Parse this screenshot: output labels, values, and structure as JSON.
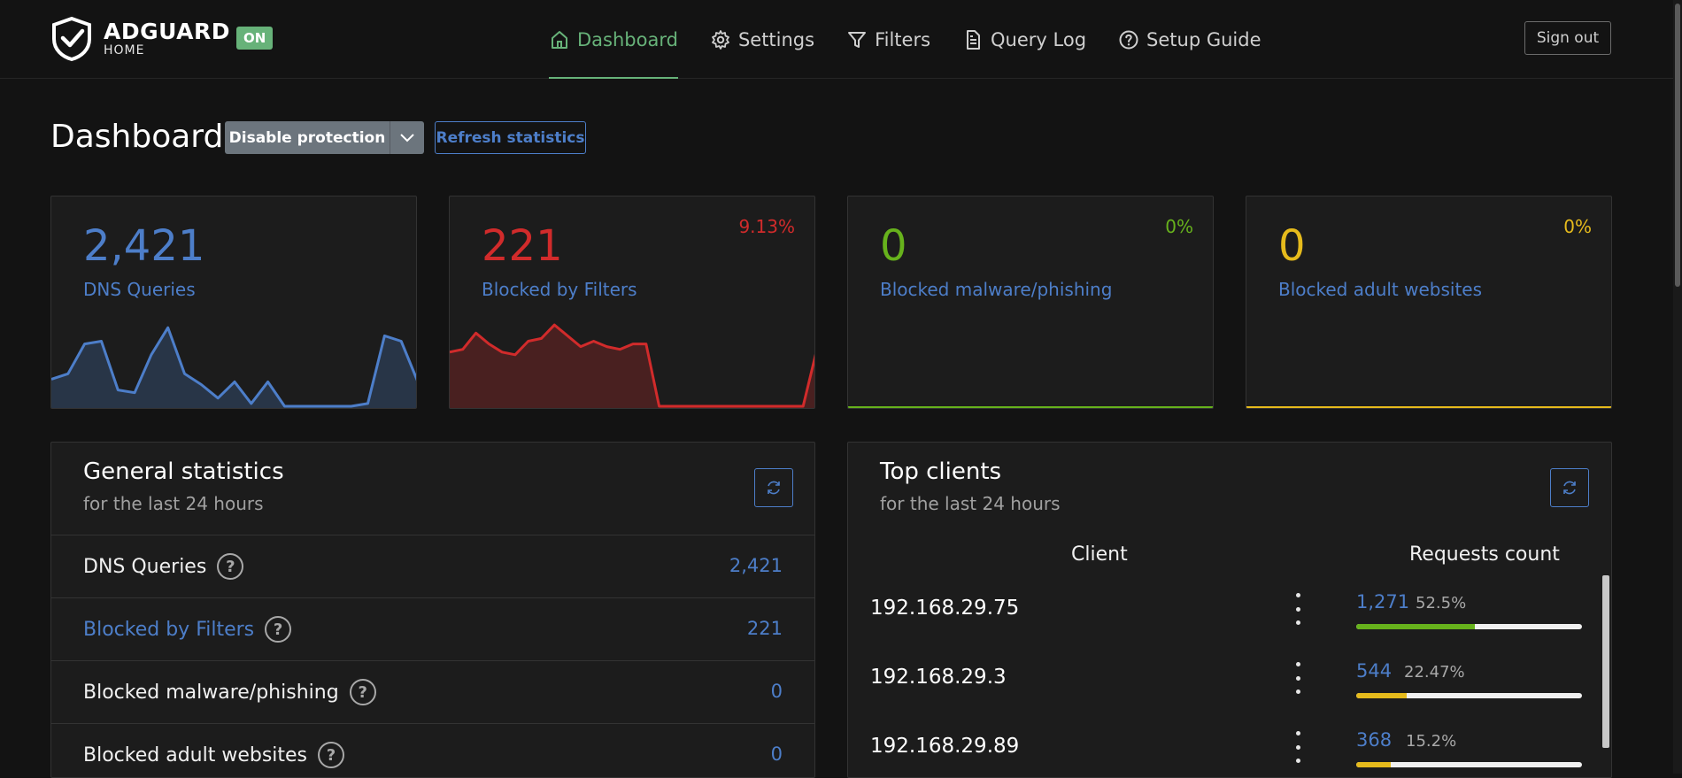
{
  "header": {
    "brand": "ADGUARD",
    "brand_sub": "HOME",
    "status_badge": "ON",
    "nav": [
      {
        "label": "Dashboard",
        "icon": "home-icon",
        "active": true
      },
      {
        "label": "Settings",
        "icon": "gear-icon",
        "active": false
      },
      {
        "label": "Filters",
        "icon": "filter-icon",
        "active": false
      },
      {
        "label": "Query Log",
        "icon": "document-icon",
        "active": false
      },
      {
        "label": "Setup Guide",
        "icon": "help-circle-icon",
        "active": false
      }
    ],
    "signout_label": "Sign out"
  },
  "dashboard": {
    "title": "Dashboard",
    "disable_label": "Disable protection",
    "refresh_label": "Refresh statistics"
  },
  "cards": [
    {
      "value": "2,421",
      "label": "DNS Queries",
      "percent": "",
      "color": "#4d7ec9",
      "spark": [
        10,
        12,
        23,
        24,
        6,
        5,
        19,
        29,
        12,
        8,
        3,
        9,
        1,
        9,
        0,
        0,
        0,
        0,
        0,
        1,
        26,
        24,
        9
      ]
    },
    {
      "value": "221",
      "label": "Blocked by Filters",
      "percent": "9.13%",
      "color": "#d12b2b",
      "spark": [
        20,
        21,
        27,
        23,
        20,
        19,
        24,
        25,
        30,
        26,
        22,
        24,
        22,
        21,
        23,
        23,
        0,
        0,
        0,
        0,
        0,
        0,
        0,
        0,
        0,
        0,
        0,
        0,
        20
      ]
    },
    {
      "value": "0",
      "label": "Blocked malware/phishing",
      "percent": "0%",
      "color": "#67b21c",
      "spark": []
    },
    {
      "value": "0",
      "label": "Blocked adult websites",
      "percent": "0%",
      "color": "#e6bb1c",
      "spark": []
    }
  ],
  "general_stats": {
    "title": "General statistics",
    "subtitle": "for the last 24 hours",
    "rows": [
      {
        "name": "DNS Queries",
        "value": "2,421",
        "highlight": false
      },
      {
        "name": "Blocked by Filters",
        "value": "221",
        "highlight": true
      },
      {
        "name": "Blocked malware/phishing",
        "value": "0",
        "highlight": false
      },
      {
        "name": "Blocked adult websites",
        "value": "0",
        "highlight": false
      }
    ]
  },
  "top_clients": {
    "title": "Top clients",
    "subtitle": "for the last 24 hours",
    "col_client": "Client",
    "col_requests": "Requests count",
    "rows": [
      {
        "ip": "192.168.29.75",
        "count": "1,271",
        "percent": "52.5%",
        "fraction": 0.525,
        "bar_color": "#67b21c"
      },
      {
        "ip": "192.168.29.3",
        "count": "544",
        "percent": "22.47%",
        "fraction": 0.2247,
        "bar_color": "#e6bb1c"
      },
      {
        "ip": "192.168.29.89",
        "count": "368",
        "percent": "15.2%",
        "fraction": 0.152,
        "bar_color": "#e6bb1c"
      }
    ]
  }
}
